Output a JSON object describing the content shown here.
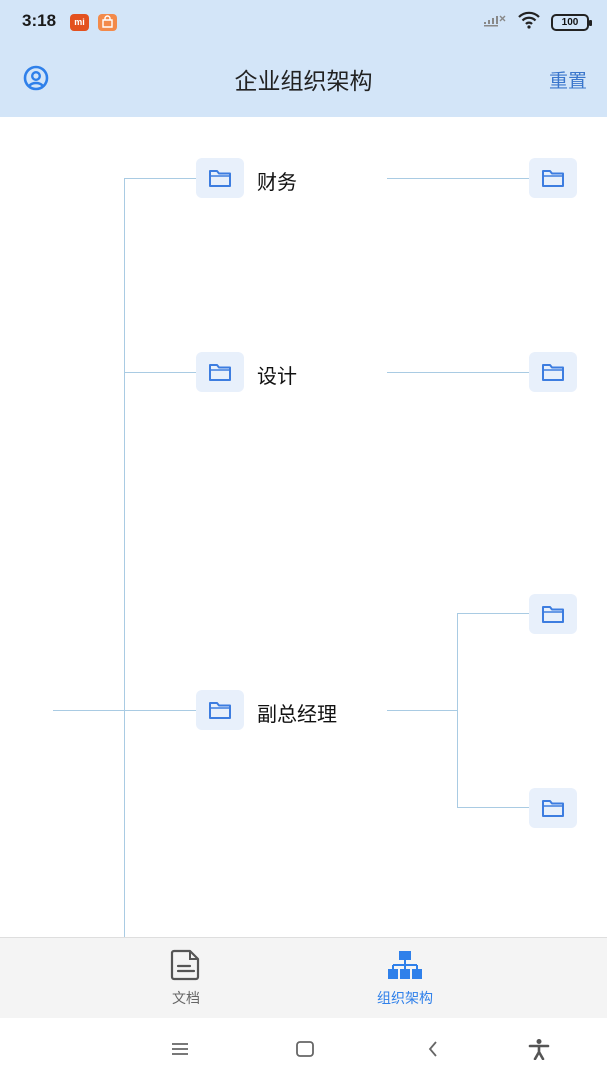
{
  "status_bar": {
    "time": "3:18",
    "battery": "100",
    "mi_badge": "mi",
    "icons": [
      "mi-app-icon",
      "shop-app-icon",
      "no-signal-icon",
      "wifi-icon",
      "battery-icon"
    ]
  },
  "toolbar": {
    "title": "企业组织架构",
    "reset_label": "重置",
    "left_icon": "user-circle-icon"
  },
  "tree": {
    "nodes": [
      {
        "label": "财务",
        "icon": "folder-icon"
      },
      {
        "label": "设计",
        "icon": "folder-icon"
      },
      {
        "label": "副总经理",
        "icon": "folder-icon"
      }
    ],
    "child_nodes": [
      {
        "parent": "财务",
        "icon": "folder-icon"
      },
      {
        "parent": "设计",
        "icon": "folder-icon"
      },
      {
        "parent": "副总经理",
        "icon": "folder-icon"
      },
      {
        "parent": "副总经理",
        "icon": "folder-icon"
      }
    ]
  },
  "bottom_nav": {
    "items": [
      {
        "label": "文档",
        "icon": "document-icon",
        "active": false
      },
      {
        "label": "组织架构",
        "icon": "org-chart-icon",
        "active": true
      }
    ]
  },
  "colors": {
    "header_bg": "#d3e5f8",
    "accent": "#2f80ea",
    "connector": "#a9cbe3",
    "node_bg": "#e8f0fb"
  },
  "system_nav": [
    "menu-icon",
    "home-icon",
    "back-icon",
    "accessibility-icon"
  ]
}
